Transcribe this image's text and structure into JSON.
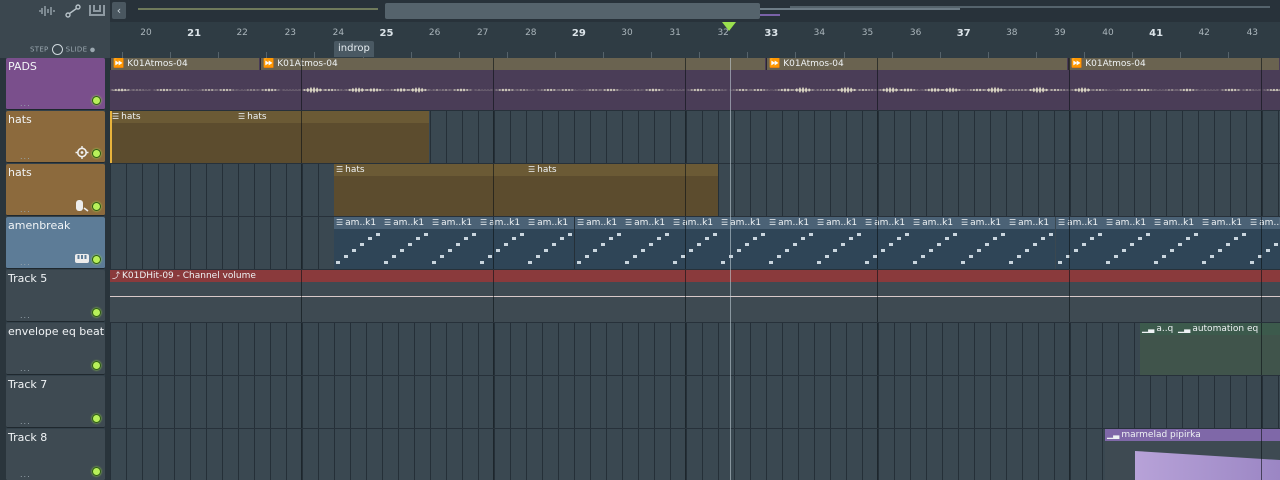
{
  "toolbar": {
    "step_label": "STEP",
    "slide_label": "SLIDE",
    "icons": [
      "waveform-icon",
      "link-icon",
      "magnet-icon"
    ]
  },
  "scroll": {
    "left_arrow": "‹"
  },
  "ruler": {
    "bars": [
      "20",
      "21",
      "22",
      "23",
      "24",
      "25",
      "26",
      "27",
      "28",
      "29",
      "30",
      "31",
      "32",
      "33",
      "34",
      "35",
      "36",
      "37",
      "38",
      "39",
      "40",
      "41",
      "42",
      "43"
    ],
    "major_bars": [
      "21",
      "25",
      "29",
      "33",
      "37",
      "41"
    ],
    "marker_label": "indrop"
  },
  "tracks": [
    {
      "name": "PADS",
      "color": "#7a4f8c",
      "icon": ""
    },
    {
      "name": "hats",
      "color": "#8c6a3d",
      "icon": "fx-icon"
    },
    {
      "name": "hats",
      "color": "#8c6a3d",
      "icon": "drum-icon"
    },
    {
      "name": "amenbreak",
      "color": "#5d7c97",
      "icon": "keys-icon"
    },
    {
      "name": "Track 5",
      "color": "#3e4a52",
      "icon": ""
    },
    {
      "name": "envelope eq beat",
      "color": "#3e4a52",
      "icon": ""
    },
    {
      "name": "Track 7",
      "color": "#3e4a52",
      "icon": ""
    },
    {
      "name": "Track 8",
      "color": "#3e4a52",
      "icon": ""
    }
  ],
  "track_dots": "...",
  "clips": {
    "pads": [
      "K01Atmos-04",
      "K01Atmos-04",
      "K01Atmos-04",
      "K01Atmos-04"
    ],
    "hats1": [
      "hats",
      "hats"
    ],
    "hats2": [
      "hats",
      "hats"
    ],
    "amen": "am..k1",
    "track5": "K01DHit-09 - Channel volume",
    "eq": [
      "a..q",
      "automation eq"
    ],
    "track8": "marmelad pipirka"
  },
  "colors": {
    "pads_clip": "#5a4a66",
    "hats_clip": "#6b5a35",
    "amen_clip": "#3d5468",
    "auto_clip": "#8a3a3c",
    "eq_clip": "#3c4d48",
    "purple_clip": "#8f73b8",
    "playhead": "#9be04e"
  }
}
